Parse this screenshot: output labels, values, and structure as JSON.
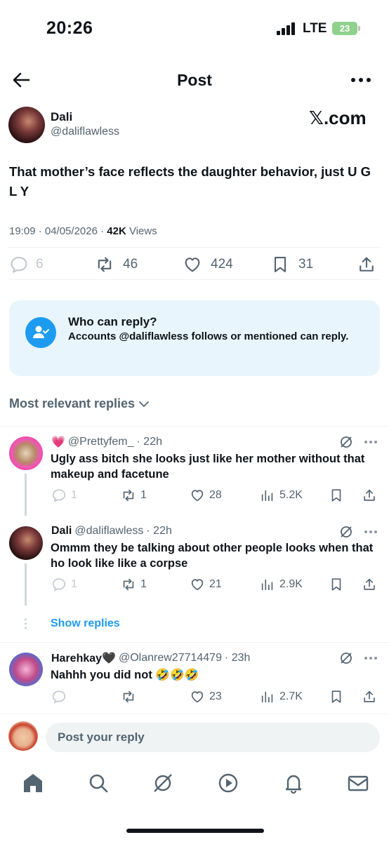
{
  "status_bar": {
    "time": "20:26",
    "network": "LTE",
    "battery": "23"
  },
  "header": {
    "title": "Post",
    "back_icon": "arrow-left-icon",
    "more_icon": "more-icon"
  },
  "post": {
    "author_name": "Dali",
    "author_handle": "@daliflawless",
    "source": "𝕏.com",
    "text": "That mother’s face reflects the daughter behavior, just U G L Y",
    "timestamp": "19:09 · 04/05/2026 · ",
    "views_count": "42K",
    "views_label": " Views",
    "stats": {
      "replies": "6",
      "reposts": "46",
      "likes": "424",
      "bookmarks": "31"
    }
  },
  "who_can_reply": {
    "title": "Who can reply?",
    "description": "Accounts @daliflawless follows or mentioned can reply."
  },
  "replies_filter": "Most relevant replies",
  "replies": [
    {
      "name": "💗",
      "handle": "@Prettyfem_",
      "time": "· 22h",
      "text": "Ugly ass bitch she looks just like her mother without that makeup and facetune",
      "replies": "1",
      "reposts": "1",
      "likes": "28",
      "views": "5.2K"
    },
    {
      "name": "Dali",
      "handle": "@daliflawless",
      "time": "· 22h",
      "text": "Ommm they be talking about other people looks when that ho look like like a corpse",
      "replies": "1",
      "reposts": "1",
      "likes": "21",
      "views": "2.9K"
    },
    {
      "name": "Harehkay🖤",
      "handle": "@Olanrew27714479",
      "time": "· 23h",
      "text": "Nahhh you did not 🤣🤣🤣",
      "replies": "",
      "reposts": "",
      "likes": "23",
      "views": "2.7K"
    }
  ],
  "show_replies": "Show replies",
  "compose": {
    "placeholder": "Post your reply"
  },
  "colors": {
    "accent": "#1d9bf0",
    "secondary_text": "#536471",
    "text": "#0f1419",
    "info_bg": "#e8f5fd"
  }
}
